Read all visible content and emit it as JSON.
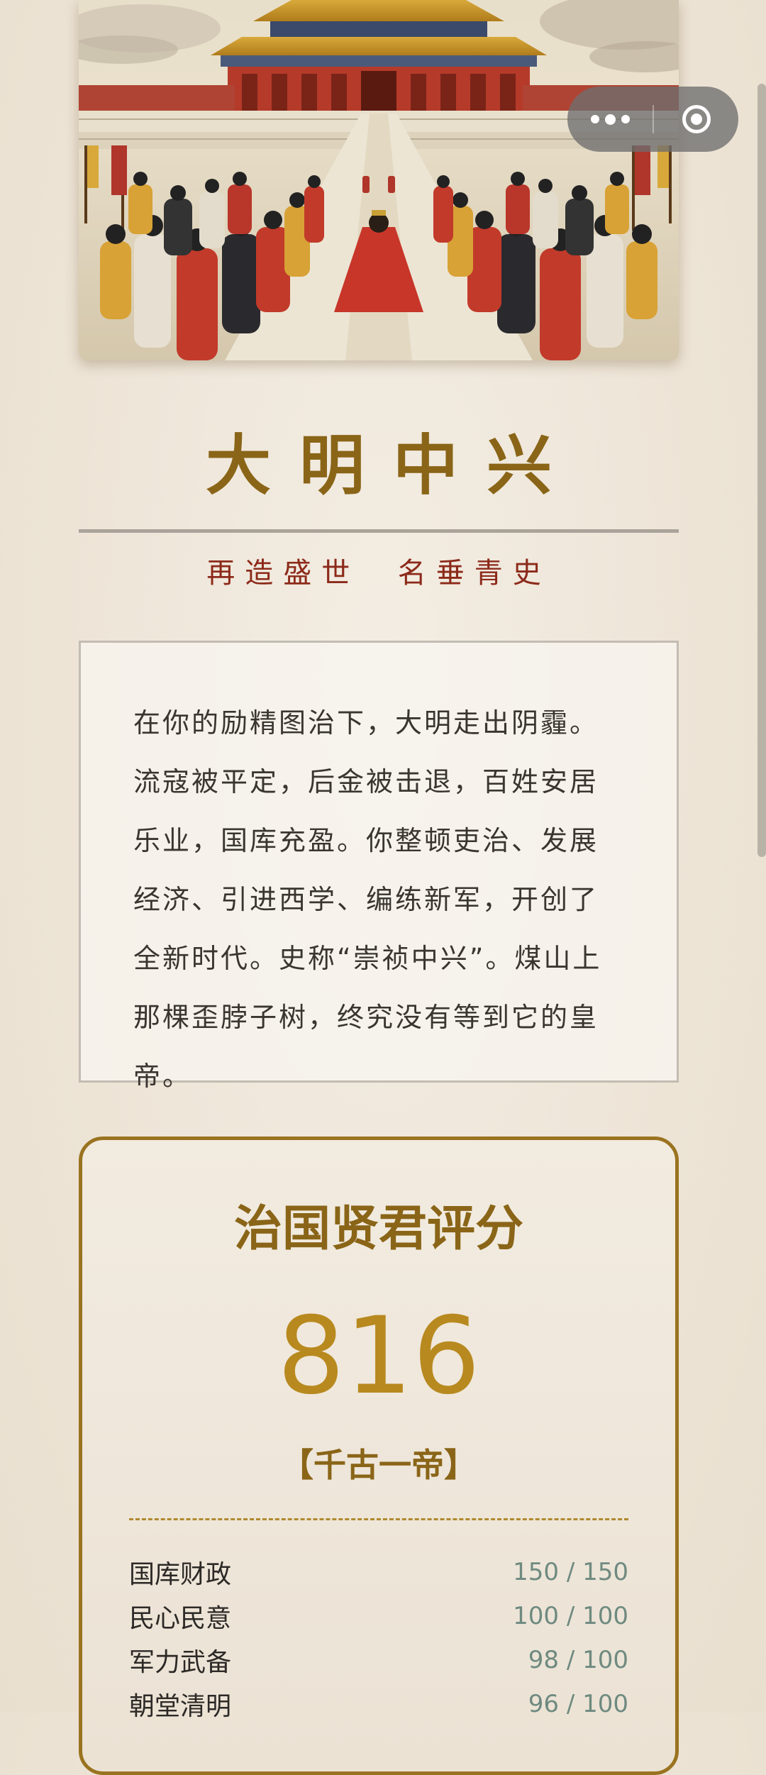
{
  "header": {
    "title": "大明中兴",
    "subtitle": "再造盛世  名垂青史"
  },
  "capsule": {
    "more_icon": "more-dots-icon",
    "close_icon": "target-close-icon"
  },
  "story": {
    "text": "在你的励精图治下，大明走出阴霾。流寇被平定，后金被击退，百姓安居乐业，国库充盈。你整顿吏治、发展经济、引进西学、编练新军，开创了全新时代。史称“崇祯中兴”。煤山上那棵歪脖子树，终究没有等到它的皇帝。"
  },
  "score": {
    "title": "治国贤君评分",
    "value": "816",
    "rank": "【千古一帝】",
    "stats": [
      {
        "label": "国库财政",
        "value": "150 / 150"
      },
      {
        "label": "民心民意",
        "value": "100 / 100"
      },
      {
        "label": "军力武备",
        "value": "98 / 100"
      },
      {
        "label": "朝堂清明",
        "value": "96 / 100"
      }
    ]
  },
  "colors": {
    "gold": "#8a6518",
    "score_gold": "#b8891f",
    "crimson": "#8c2a1a",
    "stat_value": "#6f8a80"
  }
}
